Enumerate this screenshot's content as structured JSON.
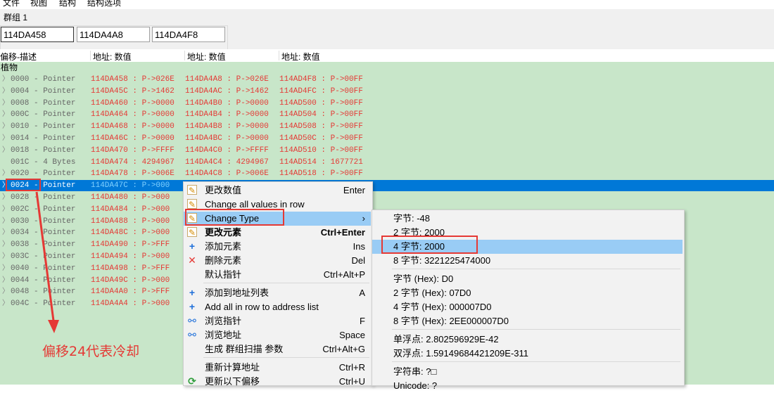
{
  "menubar": {
    "items": [
      "文件",
      "视图",
      "结构",
      "结构选项"
    ]
  },
  "group": {
    "label": "群组 1",
    "addresses": [
      "114DA458",
      "114DA4A8",
      "114DA4F8"
    ]
  },
  "columns": [
    "偏移-描述",
    "地址: 数值",
    "地址: 数值",
    "地址: 数值"
  ],
  "tree": {
    "root": "植物"
  },
  "rows": [
    {
      "name": "0000 - Pointer",
      "c1": "114DA458 : P->026E",
      "c2": "114DA4A8 : P->026E",
      "c3": "114AD4F8 : P->00FF"
    },
    {
      "name": "0004 - Pointer",
      "c1": "114DA45C : P->1462",
      "c2": "114DA4AC : P->1462",
      "c3": "114AD4FC : P->00FF"
    },
    {
      "name": "0008 - Pointer",
      "c1": "114DA460 : P->0000",
      "c2": "114DA4B0 : P->0000",
      "c3": "114AD500 : P->00FF"
    },
    {
      "name": "000C - Pointer",
      "c1": "114DA464 : P->0000",
      "c2": "114DA4B4 : P->0000",
      "c3": "114AD504 : P->00FF"
    },
    {
      "name": "0010 - Pointer",
      "c1": "114DA468 : P->0000",
      "c2": "114DA4B8 : P->0000",
      "c3": "114AD508 : P->00FF"
    },
    {
      "name": "0014 - Pointer",
      "c1": "114DA46C : P->0000",
      "c2": "114DA4BC : P->0000",
      "c3": "114AD50C : P->00FF"
    },
    {
      "name": "0018 - Pointer",
      "c1": "114DA470 : P->FFFF",
      "c2": "114DA4C0 : P->FFFF",
      "c3": "114AD510 : P->00FF"
    },
    {
      "name": "001C - 4 Bytes",
      "c1": "114DA474 : 4294967",
      "c2": "114DA4C4 : 4294967",
      "c3": "114AD514 : 1677721"
    },
    {
      "name": "0020 - Pointer",
      "c1": "114DA478 : P->006E",
      "c2": "114DA4C8 : P->006E",
      "c3": "114AD518 : P->00FF"
    },
    {
      "name": "0024 - Pointer",
      "c1": "114DA47C : P->000",
      "c2": "",
      "c3": ""
    },
    {
      "name": "0028 - Pointer",
      "c1": "114DA480 : P->000",
      "c2": "",
      "c3": ""
    },
    {
      "name": "002C - Pointer",
      "c1": "114DA484 : P->000",
      "c2": "",
      "c3": ""
    },
    {
      "name": "0030 - Pointer",
      "c1": "114DA488 : P->000",
      "c2": "",
      "c3": ""
    },
    {
      "name": "0034 - Pointer",
      "c1": "114DA48C : P->000",
      "c2": "",
      "c3": ""
    },
    {
      "name": "0038 - Pointer",
      "c1": "114DA490 : P->FFF",
      "c2": "",
      "c3": ""
    },
    {
      "name": "003C - Pointer",
      "c1": "114DA494 : P->000",
      "c2": "",
      "c3": ""
    },
    {
      "name": "0040 - Pointer",
      "c1": "114DA498 : P->FFF",
      "c2": "",
      "c3": ""
    },
    {
      "name": "0044 - Pointer",
      "c1": "114DA49C : P->000",
      "c2": "",
      "c3": ""
    },
    {
      "name": "0048 - Pointer",
      "c1": "114DA4A0 : P->FFF",
      "c2": "",
      "c3": ""
    },
    {
      "name": "004C - Pointer",
      "c1": "114DA4A4 : P->000",
      "c2": "",
      "c3": ""
    }
  ],
  "context_menu": {
    "items": [
      {
        "label": "更改数值",
        "shortcut": "Enter",
        "icon": "document-icon"
      },
      {
        "label": "Change all values in row",
        "shortcut": "",
        "icon": "document-icon"
      },
      {
        "label": "Change Type",
        "shortcut": "›",
        "icon": "document-icon"
      },
      {
        "label": "更改元素",
        "shortcut": "Ctrl+Enter",
        "icon": "document-icon"
      },
      {
        "label": "添加元素",
        "shortcut": "Ins",
        "icon": "plus-icon"
      },
      {
        "label": "删除元素",
        "shortcut": "Del",
        "icon": "cross-icon"
      },
      {
        "label": "默认指针",
        "shortcut": "Ctrl+Alt+P",
        "icon": ""
      },
      {
        "label": "添加到地址列表",
        "shortcut": "A",
        "icon": "plus-icon"
      },
      {
        "label": "Add all in row to address list",
        "shortcut": "",
        "icon": "plus-icon"
      },
      {
        "label": "浏览指针",
        "shortcut": "F",
        "icon": "binoculars-icon"
      },
      {
        "label": "浏览地址",
        "shortcut": "Space",
        "icon": "binoculars-icon"
      },
      {
        "label": "生成 群组扫描 参数",
        "shortcut": "Ctrl+Alt+G",
        "icon": ""
      },
      {
        "label": "重新计算地址",
        "shortcut": "Ctrl+R",
        "icon": ""
      },
      {
        "label": "更新以下偏移",
        "shortcut": "Ctrl+U",
        "icon": "refresh-icon"
      }
    ]
  },
  "type_submenu": {
    "items": [
      "字节: -48",
      "2 字节: 2000",
      "4 字节: 2000",
      "8 字节: 3221225474000",
      "字节 (Hex): D0",
      "2 字节 (Hex): 07D0",
      "4 字节 (Hex): 000007D0",
      "8 字节 (Hex): 2EE000007D0",
      "单浮点: 2.802596929E-42",
      "双浮点: 1.59149684421209E-311",
      "字符串: ?□",
      "Unicode: ?"
    ]
  },
  "annotation": "偏移24代表冷却",
  "colors": {
    "tree_bg": "#c8e6c9",
    "selection": "#0078d7",
    "value_red": "#e53935",
    "menu_bg": "#f2f2f2",
    "menu_highlight": "#99ccf5",
    "annotation": "#e53935"
  }
}
